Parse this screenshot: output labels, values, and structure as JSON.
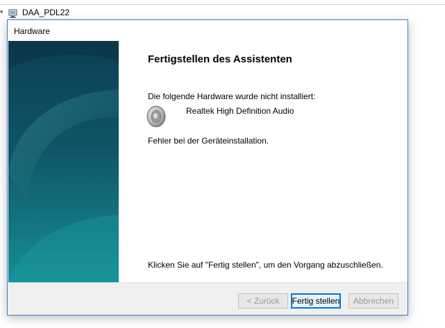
{
  "background": {
    "tree_item_label": "DAA_PDL22"
  },
  "dialog": {
    "title": "Hardware",
    "heading": "Fertigstellen des Assistenten",
    "intro": "Die folgende Hardware wurde nicht installiert:",
    "device_name": "Realtek High Definition Audio",
    "error_text": "Fehler bei der Geräteinstallation.",
    "finish_hint": "Klicken Sie auf \"Fertig stellen\", um den Vorgang abzuschließen.",
    "buttons": {
      "back_label": "< Zurück",
      "finish_label": "Fertig stellen",
      "cancel_label": "Abbrechen"
    },
    "icons": {
      "device": "speaker-icon",
      "tree_item": "computer-icon",
      "expand": "chevron-down-icon"
    },
    "colors": {
      "accent_border": "#0078d7",
      "banner_dark": "#0d4a5e",
      "banner_light": "#1a8a95"
    }
  }
}
